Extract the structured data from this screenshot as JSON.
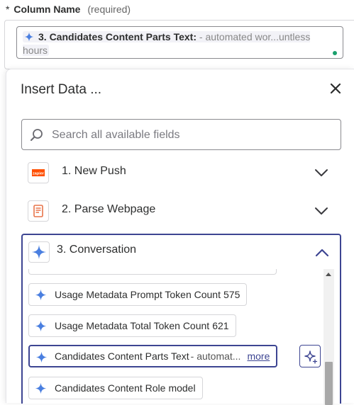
{
  "field": {
    "required_marker": "*",
    "name": "Column Name",
    "required_text": "(required)",
    "pill_title": "3. Candidates Content Parts Text:",
    "pill_value_line1": "- automated wor...untless",
    "pill_value_line2": "hours"
  },
  "panel": {
    "title": "Insert Data ...",
    "close_icon": "×",
    "search_placeholder": "Search all available fields"
  },
  "steps": [
    {
      "label": "1. New Push",
      "icon": "zapier-logo-icon",
      "expanded": false
    },
    {
      "label": "2. Parse Webpage",
      "icon": "webpage-parser-icon",
      "expanded": false
    },
    {
      "label": "3. Conversation",
      "icon": "ai-sparkle-icon",
      "expanded": true
    }
  ],
  "fields": [
    {
      "name": "Usage Metadata Prompt Token Count",
      "value": "575"
    },
    {
      "name": "Usage Metadata Total Token Count",
      "value": "621"
    },
    {
      "name": "Candidates Content Parts Text",
      "value": "- automat...",
      "more": "more",
      "selected": true
    },
    {
      "name": "Candidates Content Role",
      "value": "model"
    }
  ],
  "colors": {
    "accent": "#3d4592",
    "sparkle": "#4a7fe0",
    "zapier_orange": "#ff4f00",
    "status_dot": "#1aa06d"
  }
}
